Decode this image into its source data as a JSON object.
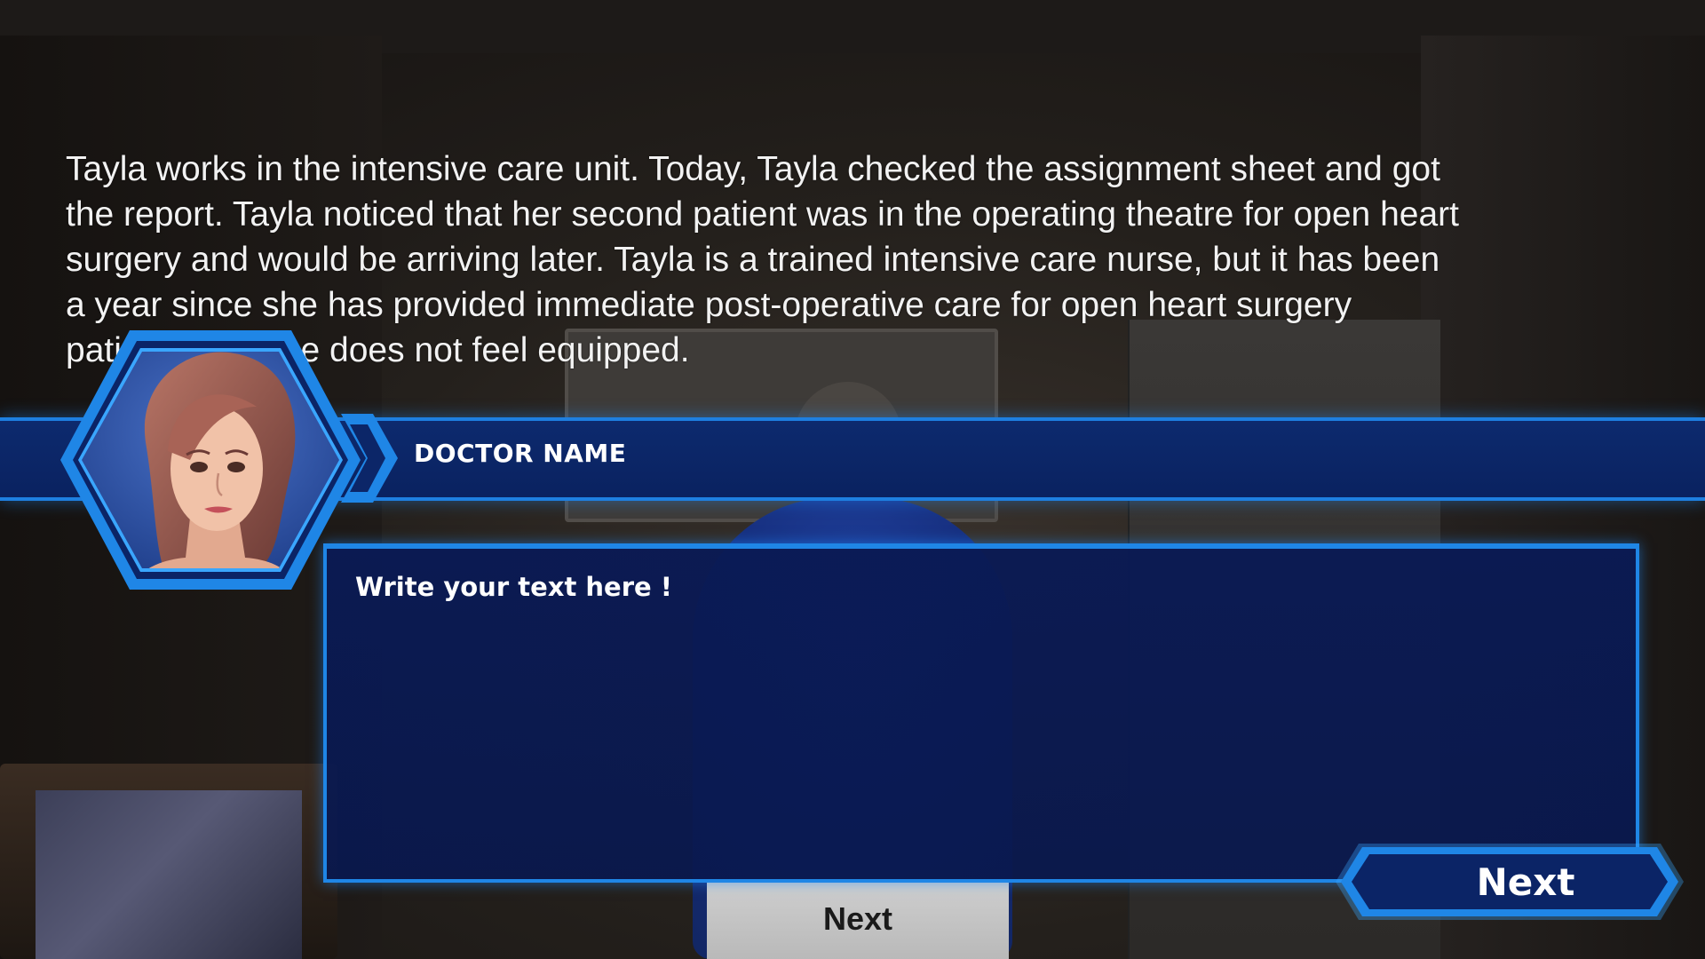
{
  "story": {
    "lines": [
      "Tayla works in the intensive care unit. Today, Tayla checked the assignment sheet and got",
      "the report. Tayla noticed that her second patient was in the operating theatre for open heart",
      "surgery and would be arriving later. Tayla is a  trained intensive care nurse, but it has been",
      "a year since she has provided immediate post-operative care for open heart surgery",
      "patients and she does not feel equipped."
    ]
  },
  "speaker": {
    "name": "DOCTOR NAME",
    "portrait_icon": "female-avatar-portrait"
  },
  "dialogue": {
    "text": "Write your text here !"
  },
  "scene": {
    "next_label": "Next"
  },
  "next_button": {
    "label": "Next"
  },
  "colors": {
    "accent": "#1f86e6",
    "panel": "#0a2260",
    "glow": "#3aa6ff"
  }
}
